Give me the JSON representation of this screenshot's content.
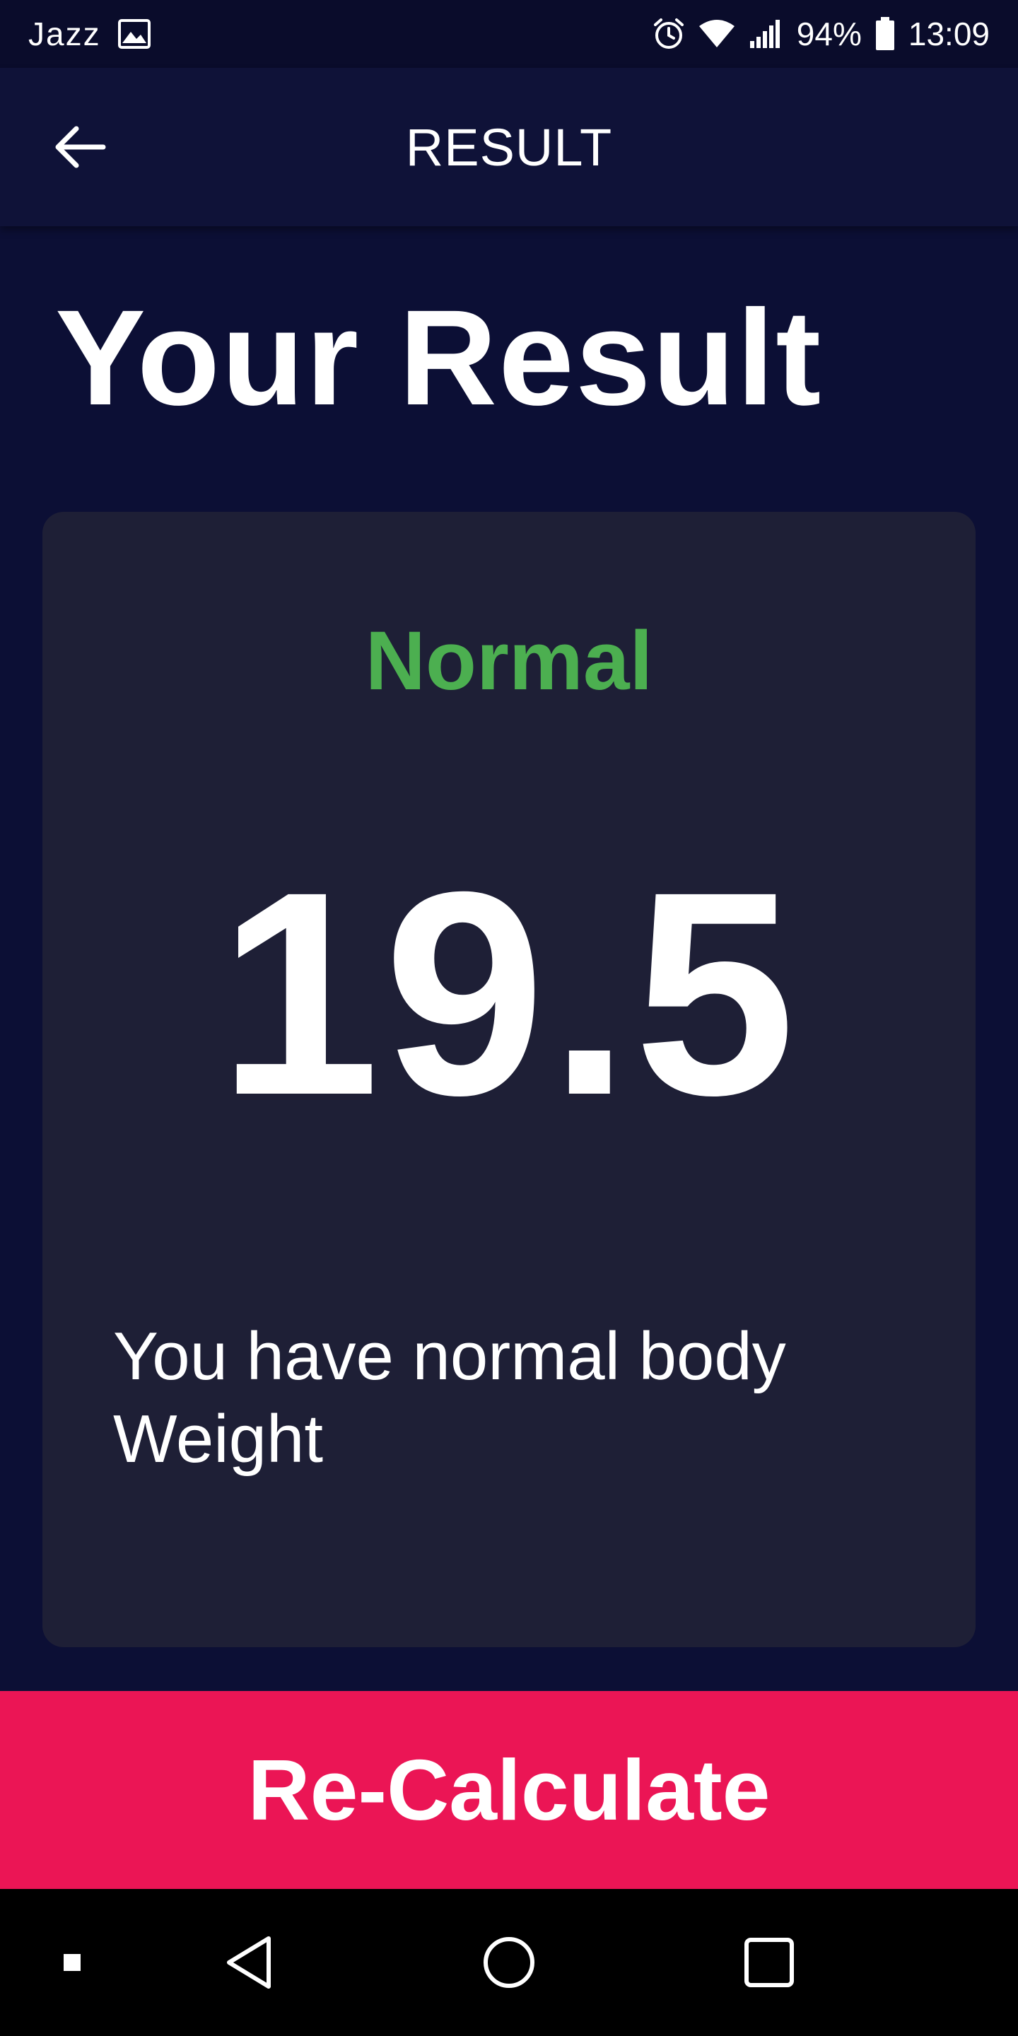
{
  "status_bar": {
    "carrier": "Jazz",
    "battery": "94%",
    "time": "13:09",
    "icons": [
      "image-icon",
      "alarm-icon",
      "wifi-icon",
      "signal-icon",
      "battery-icon"
    ]
  },
  "app_bar": {
    "title": "RESULT",
    "back_icon": "arrow-back-icon"
  },
  "main": {
    "heading": "Your Result",
    "card": {
      "status": "Normal",
      "bmi": "19.5",
      "message": "You have normal body Weight"
    }
  },
  "recalculate_label": "Re-Calculate",
  "navigation": {
    "icons": [
      "menu-dot-icon",
      "back-triangle-icon",
      "home-circle-icon",
      "recents-square-icon"
    ]
  },
  "colors": {
    "background": "#0c0f35",
    "app_bar": "#0f1238",
    "card": "#1e1f36",
    "status_green": "#4caf50",
    "accent_pink": "#eb1555"
  }
}
